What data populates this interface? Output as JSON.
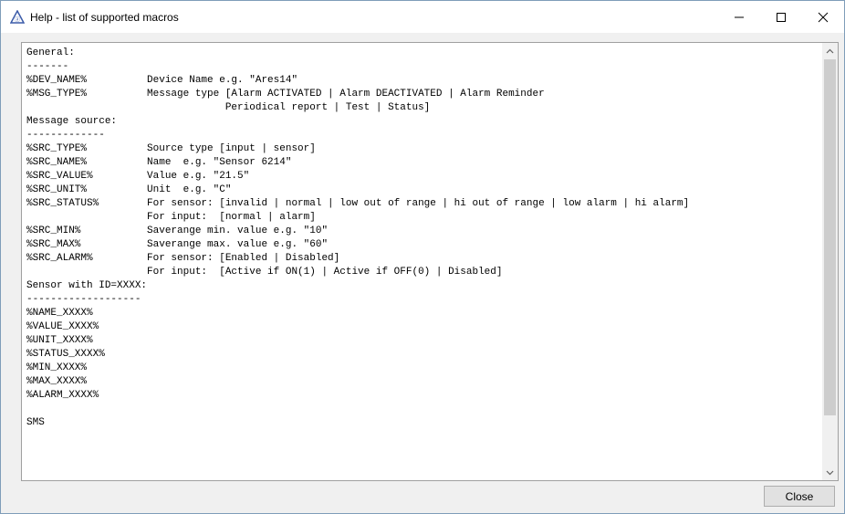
{
  "window": {
    "title": "Help - list of supported macros",
    "app_icon": "warning-triangle-icon",
    "caption_buttons": {
      "minimize": "—",
      "maximize": "☐",
      "close": "✕"
    }
  },
  "content": {
    "lines": [
      "General:",
      "-------",
      "%DEV_NAME%          Device Name e.g. \"Ares14\"",
      "%MSG_TYPE%          Message type [Alarm ACTIVATED | Alarm DEACTIVATED | Alarm Reminder",
      "                                 Periodical report | Test | Status]",
      "Message source:",
      "-------------",
      "%SRC_TYPE%          Source type [input | sensor]",
      "%SRC_NAME%          Name  e.g. \"Sensor 6214\"",
      "%SRC_VALUE%         Value e.g. \"21.5\"",
      "%SRC_UNIT%          Unit  e.g. \"C\"",
      "%SRC_STATUS%        For sensor: [invalid | normal | low out of range | hi out of range | low alarm | hi alarm]",
      "                    For input:  [normal | alarm]",
      "%SRC_MIN%           Saverange min. value e.g. \"10\"",
      "%SRC_MAX%           Saverange max. value e.g. \"60\"",
      "%SRC_ALARM%         For sensor: [Enabled | Disabled]",
      "                    For input:  [Active if ON(1) | Active if OFF(0) | Disabled]",
      "Sensor with ID=XXXX:",
      "-------------------",
      "%NAME_XXXX%",
      "%VALUE_XXXX%",
      "%UNIT_XXXX%",
      "%STATUS_XXXX%",
      "%MIN_XXXX%",
      "%MAX_XXXX%",
      "%ALARM_XXXX%",
      "",
      "SMS"
    ]
  },
  "scrollbar": {
    "up": "▲",
    "down": "▼",
    "position": 0.0
  },
  "buttons": {
    "close_label": "Close"
  }
}
